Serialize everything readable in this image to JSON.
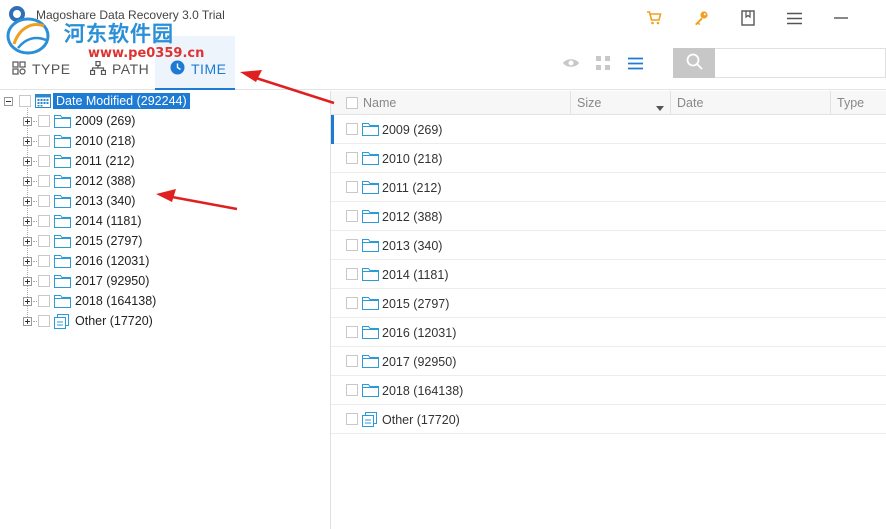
{
  "window": {
    "title": "Magoshare Data Recovery 3.0 Trial"
  },
  "watermark": {
    "main_text": "河东软件园",
    "sub_text": "www.pe0359.cn"
  },
  "tabs": [
    {
      "label": "TYPE",
      "icon": "type-icon"
    },
    {
      "label": "PATH",
      "icon": "path-icon"
    },
    {
      "label": "TIME",
      "icon": "clock-icon",
      "active": true
    }
  ],
  "search": {
    "placeholder": "",
    "value": ""
  },
  "tree": {
    "root": {
      "label": "Date Modified (292244)"
    },
    "items": [
      {
        "label": "2009 (269)"
      },
      {
        "label": "2010 (218)"
      },
      {
        "label": "2011 (212)"
      },
      {
        "label": "2012 (388)"
      },
      {
        "label": "2013 (340)"
      },
      {
        "label": "2014 (1181)"
      },
      {
        "label": "2015 (2797)"
      },
      {
        "label": "2016 (12031)"
      },
      {
        "label": "2017 (92950)"
      },
      {
        "label": "2018 (164138)"
      },
      {
        "label": "Other (17720)"
      }
    ]
  },
  "list": {
    "columns": [
      "Name",
      "Size",
      "Date",
      "Type"
    ],
    "rows": [
      {
        "label": "2009 (269)"
      },
      {
        "label": "2010 (218)"
      },
      {
        "label": "2011 (212)"
      },
      {
        "label": "2012 (388)"
      },
      {
        "label": "2013 (340)"
      },
      {
        "label": "2014 (1181)"
      },
      {
        "label": "2015 (2797)"
      },
      {
        "label": "2016 (12031)"
      },
      {
        "label": "2017 (92950)"
      },
      {
        "label": "2018 (164138)"
      },
      {
        "label": "Other (17720)"
      }
    ]
  },
  "colors": {
    "accent": "#1e7bd4",
    "folder": "#2b9bd8",
    "cart": "#f0a020",
    "key": "#f0a020",
    "arrow": "#e02020"
  }
}
